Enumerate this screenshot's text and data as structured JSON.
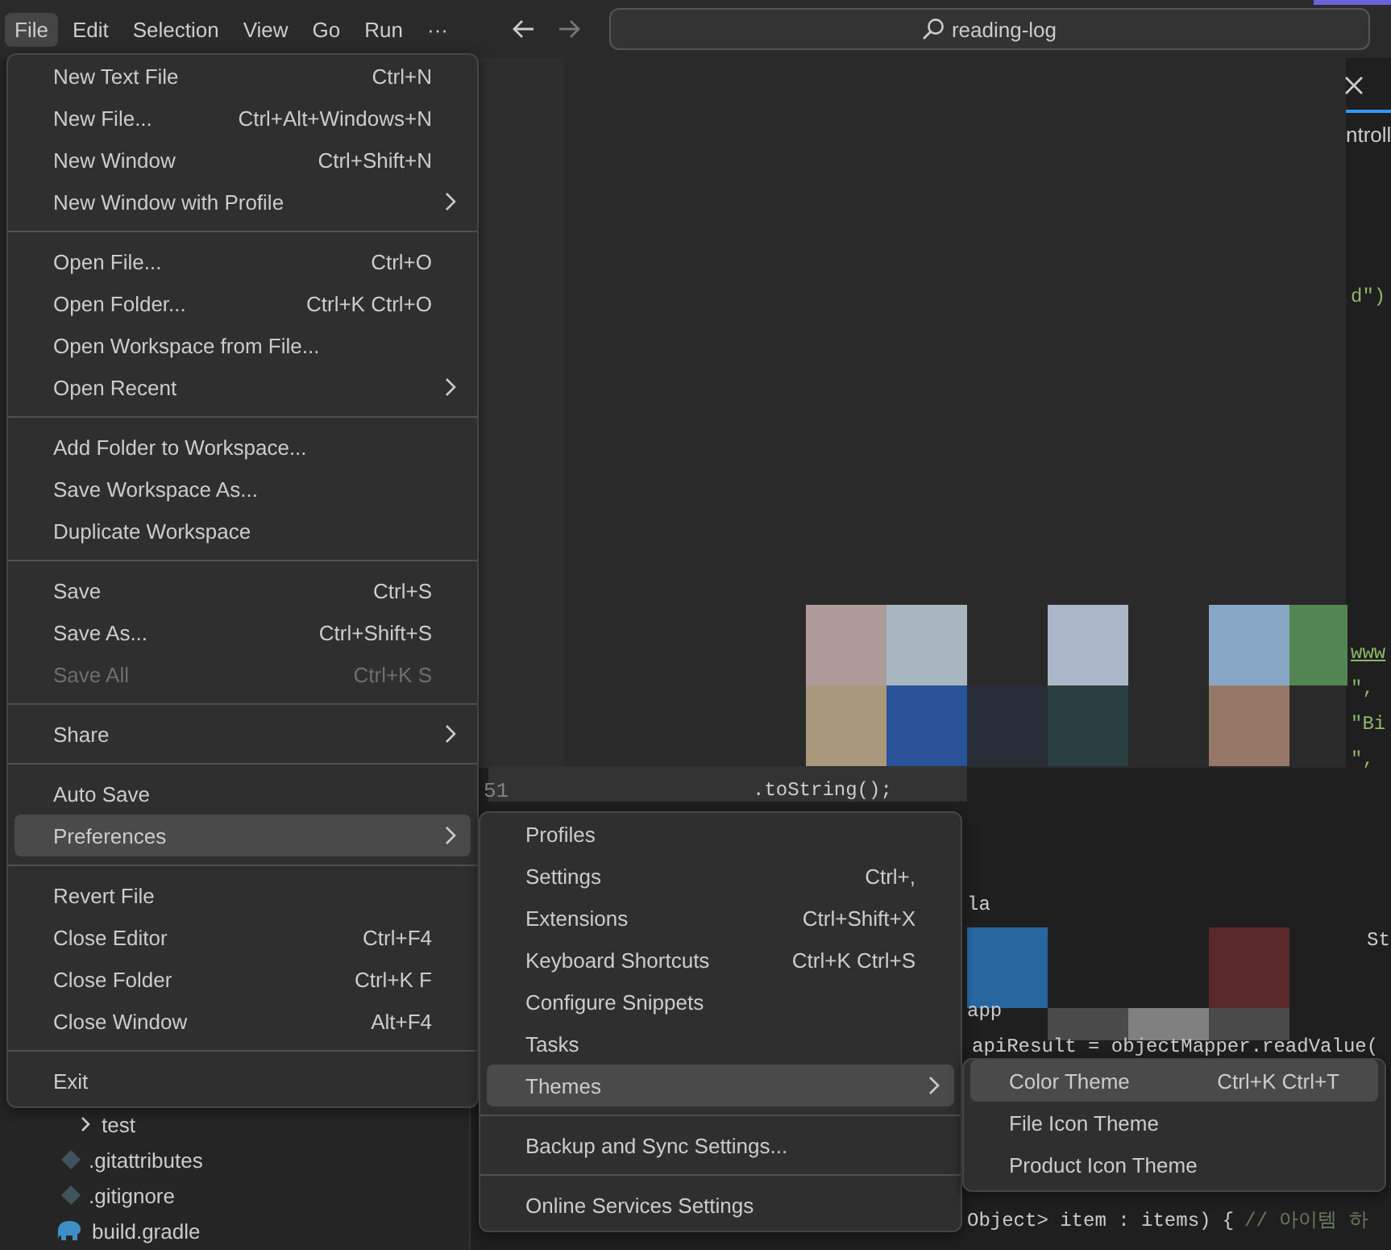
{
  "menu_bar": {
    "items": [
      {
        "label": "File",
        "selected": true
      },
      {
        "label": "Edit",
        "selected": false
      },
      {
        "label": "Selection",
        "selected": false
      },
      {
        "label": "View",
        "selected": false
      },
      {
        "label": "Go",
        "selected": false
      },
      {
        "label": "Run",
        "selected": false
      },
      {
        "label": "···",
        "selected": false
      }
    ]
  },
  "command_center": {
    "text": "reading-log"
  },
  "editor": {
    "tab_fragment": "ntroll",
    "line_number": "51",
    "code_fragments": [
      {
        "text": "d\")",
        "kind": "string"
      },
      {
        "text": "www",
        "kind": "link"
      },
      {
        "text": "\",",
        "kind": "string"
      },
      {
        "text": "\"Bi",
        "kind": "string"
      },
      {
        "text": "\",",
        "kind": "string"
      },
      {
        "text": ".toString();",
        "kind": "code"
      },
      {
        "text": "la",
        "kind": "code"
      },
      {
        "text": "St",
        "kind": "code"
      },
      {
        "text": "app",
        "kind": "code"
      },
      {
        "text": "apiResult = objectMapper.readValue(",
        "kind": "code"
      },
      {
        "text": "Object> item : items) {",
        "kind": "code"
      },
      {
        "text": "// 아이템 하",
        "kind": "comment"
      }
    ]
  },
  "sidebar": {
    "tree": [
      {
        "label": "test",
        "kind": "folder",
        "expanded": false
      },
      {
        "label": ".gitattributes",
        "kind": "git"
      },
      {
        "label": ".gitignore",
        "kind": "git"
      },
      {
        "label": "build.gradle",
        "kind": "gradle"
      }
    ]
  },
  "file_menu": {
    "groups": [
      {
        "items": [
          {
            "label": "New Text File",
            "shortcut": "Ctrl+N",
            "submenu": false,
            "selected": false,
            "disabled": false
          },
          {
            "label": "New File...",
            "shortcut": "Ctrl+Alt+Windows+N",
            "submenu": false,
            "selected": false,
            "disabled": false
          },
          {
            "label": "New Window",
            "shortcut": "Ctrl+Shift+N",
            "submenu": false,
            "selected": false,
            "disabled": false
          },
          {
            "label": "New Window with Profile",
            "submenu": true,
            "selected": false,
            "disabled": false
          }
        ]
      },
      {
        "items": [
          {
            "label": "Open File...",
            "shortcut": "Ctrl+O",
            "submenu": false,
            "selected": false,
            "disabled": false
          },
          {
            "label": "Open Folder...",
            "shortcut": "Ctrl+K Ctrl+O",
            "submenu": false,
            "selected": false,
            "disabled": false
          },
          {
            "label": "Open Workspace from File...",
            "submenu": false,
            "selected": false,
            "disabled": false
          },
          {
            "label": "Open Recent",
            "submenu": true,
            "selected": false,
            "disabled": false
          }
        ]
      },
      {
        "items": [
          {
            "label": "Add Folder to Workspace...",
            "submenu": false,
            "selected": false,
            "disabled": false
          },
          {
            "label": "Save Workspace As...",
            "submenu": false,
            "selected": false,
            "disabled": false
          },
          {
            "label": "Duplicate Workspace",
            "submenu": false,
            "selected": false,
            "disabled": false
          }
        ]
      },
      {
        "items": [
          {
            "label": "Save",
            "shortcut": "Ctrl+S",
            "submenu": false,
            "selected": false,
            "disabled": false
          },
          {
            "label": "Save As...",
            "shortcut": "Ctrl+Shift+S",
            "submenu": false,
            "selected": false,
            "disabled": false
          },
          {
            "label": "Save All",
            "shortcut": "Ctrl+K S",
            "submenu": false,
            "selected": false,
            "disabled": true
          }
        ]
      },
      {
        "items": [
          {
            "label": "Share",
            "submenu": true,
            "selected": false,
            "disabled": false
          }
        ]
      },
      {
        "items": [
          {
            "label": "Auto Save",
            "submenu": false,
            "selected": false,
            "disabled": false
          },
          {
            "label": "Preferences",
            "submenu": true,
            "selected": true,
            "disabled": false
          }
        ]
      },
      {
        "items": [
          {
            "label": "Revert File",
            "submenu": false,
            "selected": false,
            "disabled": false
          },
          {
            "label": "Close Editor",
            "shortcut": "Ctrl+F4",
            "submenu": false,
            "selected": false,
            "disabled": false
          },
          {
            "label": "Close Folder",
            "shortcut": "Ctrl+K F",
            "submenu": false,
            "selected": false,
            "disabled": false
          },
          {
            "label": "Close Window",
            "shortcut": "Alt+F4",
            "submenu": false,
            "selected": false,
            "disabled": false
          }
        ]
      },
      {
        "items": [
          {
            "label": "Exit",
            "submenu": false,
            "selected": false,
            "disabled": false
          }
        ]
      }
    ]
  },
  "preferences_menu": {
    "groups": [
      {
        "items": [
          {
            "label": "Profiles",
            "submenu": false,
            "selected": false,
            "disabled": false
          },
          {
            "label": "Settings",
            "shortcut": "Ctrl+,",
            "submenu": false,
            "selected": false,
            "disabled": false
          },
          {
            "label": "Extensions",
            "shortcut": "Ctrl+Shift+X",
            "submenu": false,
            "selected": false,
            "disabled": false
          },
          {
            "label": "Keyboard Shortcuts",
            "shortcut": "Ctrl+K Ctrl+S",
            "submenu": false,
            "selected": false,
            "disabled": false
          },
          {
            "label": "Configure Snippets",
            "submenu": false,
            "selected": false,
            "disabled": false
          },
          {
            "label": "Tasks",
            "submenu": false,
            "selected": false,
            "disabled": false
          },
          {
            "label": "Themes",
            "submenu": true,
            "selected": true,
            "disabled": false
          }
        ]
      },
      {
        "items": [
          {
            "label": "Backup and Sync Settings...",
            "submenu": false,
            "selected": false,
            "disabled": false
          }
        ]
      },
      {
        "items": [
          {
            "label": "Online Services Settings",
            "submenu": false,
            "selected": false,
            "disabled": false
          }
        ]
      }
    ]
  },
  "themes_menu": {
    "groups": [
      {
        "items": [
          {
            "label": "Color Theme",
            "shortcut": "Ctrl+K Ctrl+T",
            "submenu": false,
            "selected": true,
            "disabled": false
          },
          {
            "label": "File Icon Theme",
            "submenu": false,
            "selected": false,
            "disabled": false
          },
          {
            "label": "Product Icon Theme",
            "submenu": false,
            "selected": false,
            "disabled": false
          }
        ]
      }
    ]
  }
}
